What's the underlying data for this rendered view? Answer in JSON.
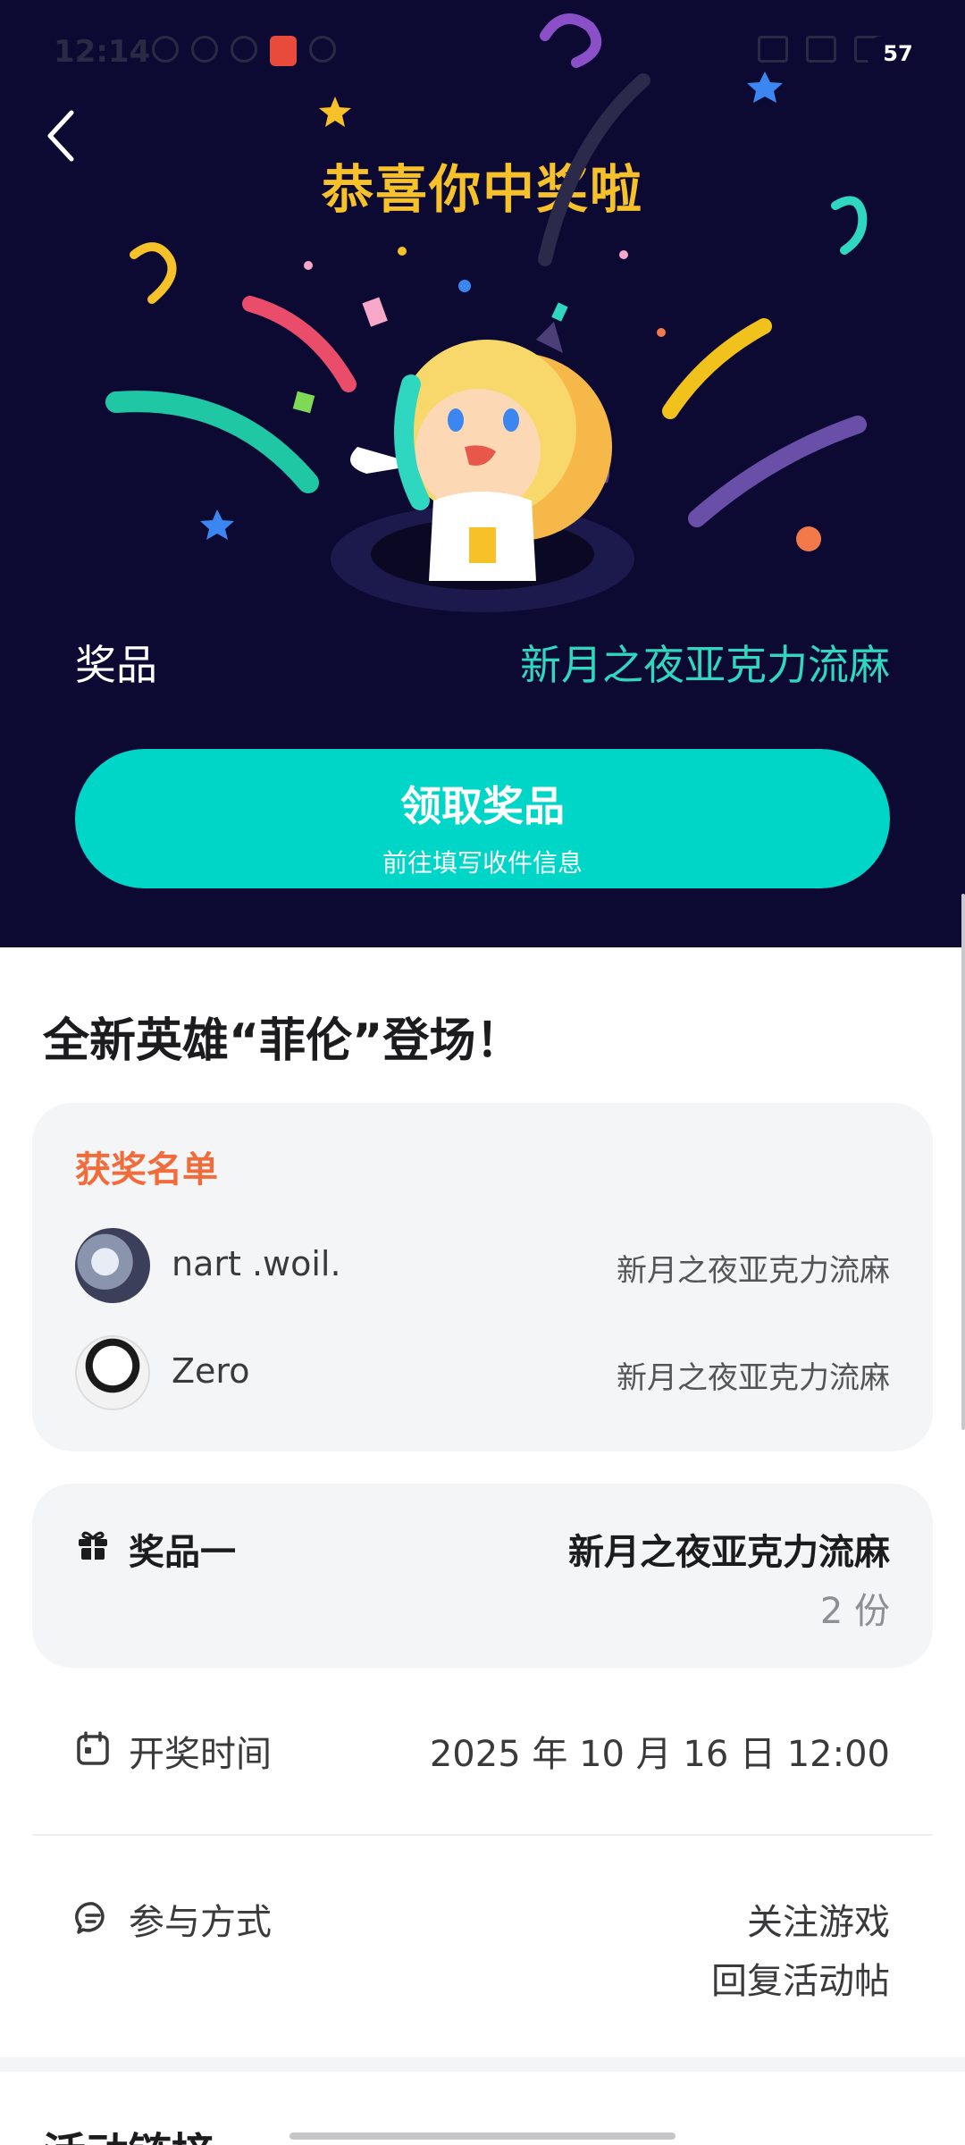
{
  "status_bar": {
    "time": "12:14",
    "battery": "57"
  },
  "hero": {
    "congrats": "恭喜你中奖啦",
    "prize_label": "奖品",
    "prize_value": "新月之夜亚克力流麻",
    "claim_title": "领取奖品",
    "claim_subtitle": "前往填写收件信息"
  },
  "event": {
    "title": "全新英雄“菲伦”登场！"
  },
  "winners": {
    "title": "获奖名单",
    "list": [
      {
        "name": "nart .woil.",
        "prize": "新月之夜亚克力流麻"
      },
      {
        "name": "Zero",
        "prize": "新月之夜亚克力流麻"
      }
    ]
  },
  "prize_card": {
    "tier": "奖品一",
    "name": "新月之夜亚克力流麻",
    "quantity": "2 份"
  },
  "draw_time": {
    "label": "开奖时间",
    "value": "2025 年 10 月 16 日 12:00"
  },
  "participation": {
    "label": "参与方式",
    "lines": [
      "关注游戏",
      "回复活动帖"
    ]
  },
  "next_section": {
    "title": "活动链接"
  },
  "colors": {
    "hero_bg": "#0c0a33",
    "accent_teal": "#00d6c7",
    "title_gold": "#f7c12a",
    "winners_orange": "#f26b3a"
  }
}
